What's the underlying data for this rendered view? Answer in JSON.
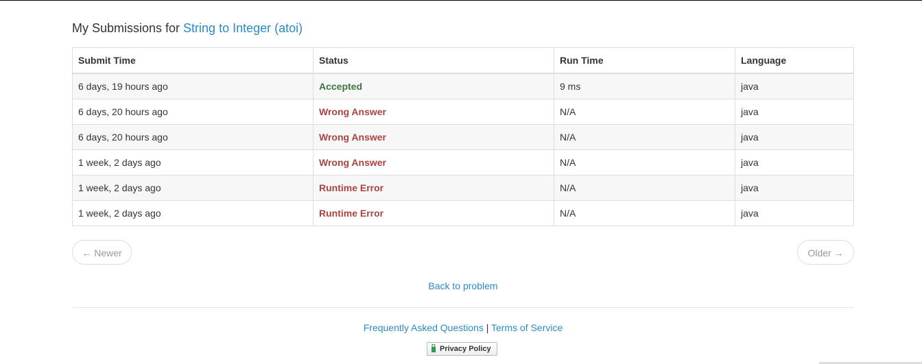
{
  "heading": {
    "prefix": "My Submissions for ",
    "problem_title": "String to Integer (atoi)"
  },
  "table": {
    "columns": [
      "Submit Time",
      "Status",
      "Run Time",
      "Language"
    ],
    "rows": [
      {
        "submit_time": "6 days, 19 hours ago",
        "status": "Accepted",
        "run_time": "9 ms",
        "language": "java"
      },
      {
        "submit_time": "6 days, 20 hours ago",
        "status": "Wrong Answer",
        "run_time": "N/A",
        "language": "java"
      },
      {
        "submit_time": "6 days, 20 hours ago",
        "status": "Wrong Answer",
        "run_time": "N/A",
        "language": "java"
      },
      {
        "submit_time": "1 week, 2 days ago",
        "status": "Wrong Answer",
        "run_time": "N/A",
        "language": "java"
      },
      {
        "submit_time": "1 week, 2 days ago",
        "status": "Runtime Error",
        "run_time": "N/A",
        "language": "java"
      },
      {
        "submit_time": "1 week, 2 days ago",
        "status": "Runtime Error",
        "run_time": "N/A",
        "language": "java"
      }
    ]
  },
  "pager": {
    "newer_label": "← Newer",
    "older_label": "Older →"
  },
  "back_link": "Back to problem",
  "footer": {
    "faq": "Frequently Asked Questions",
    "separator": "|",
    "terms": "Terms of Service",
    "privacy": "Privacy Policy"
  },
  "colors": {
    "link": "#2a8ac8",
    "accepted": "#3c763d",
    "error": "#a94442"
  }
}
